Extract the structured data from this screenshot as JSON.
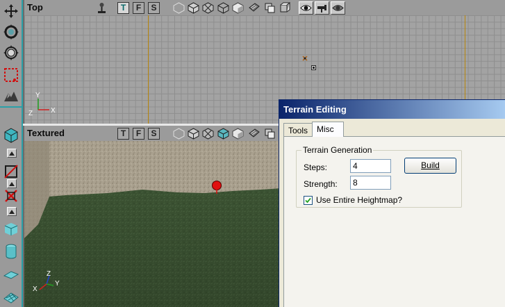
{
  "left_toolbar": {
    "tools": [
      {
        "name": "move-icon"
      },
      {
        "name": "rotate-icon"
      },
      {
        "name": "scale-icon"
      },
      {
        "name": "marquee-select-icon"
      },
      {
        "name": "terrain-tool-icon"
      },
      {
        "name": "cube-brush-icon"
      },
      {
        "name": "slice-icon"
      },
      {
        "name": "cut-icon"
      },
      {
        "name": "box-primitive-icon"
      },
      {
        "name": "cylinder-primitive-icon"
      },
      {
        "name": "plane-primitive-icon"
      },
      {
        "name": "terrain-primitive-icon"
      }
    ]
  },
  "viewport_top": {
    "title": "Top",
    "view_letters": [
      "T",
      "F",
      "S"
    ],
    "active_letter": "T",
    "axes": {
      "y": "Y",
      "z": "Z",
      "x": "X"
    }
  },
  "viewport_textured": {
    "title": "Textured",
    "view_letters": [
      "T",
      "F",
      "S"
    ],
    "axes": {
      "z": "Z",
      "y": "Y",
      "x": "X"
    }
  },
  "terrain_editing": {
    "title": "Terrain Editing",
    "tabs": [
      {
        "label": "Tools",
        "active": false
      },
      {
        "label": "Misc",
        "active": true
      }
    ],
    "group_title": "Terrain Generation",
    "steps_label": "Steps:",
    "steps_value": "4",
    "strength_label": "Strength:",
    "strength_value": "8",
    "build_label": "Build",
    "use_heightmap_label": "Use Entire Heightmap?",
    "use_heightmap_checked": true
  },
  "colors": {
    "accent": "#2aa0a8",
    "title_bar": "#0a246a",
    "marker": "#e01010"
  }
}
